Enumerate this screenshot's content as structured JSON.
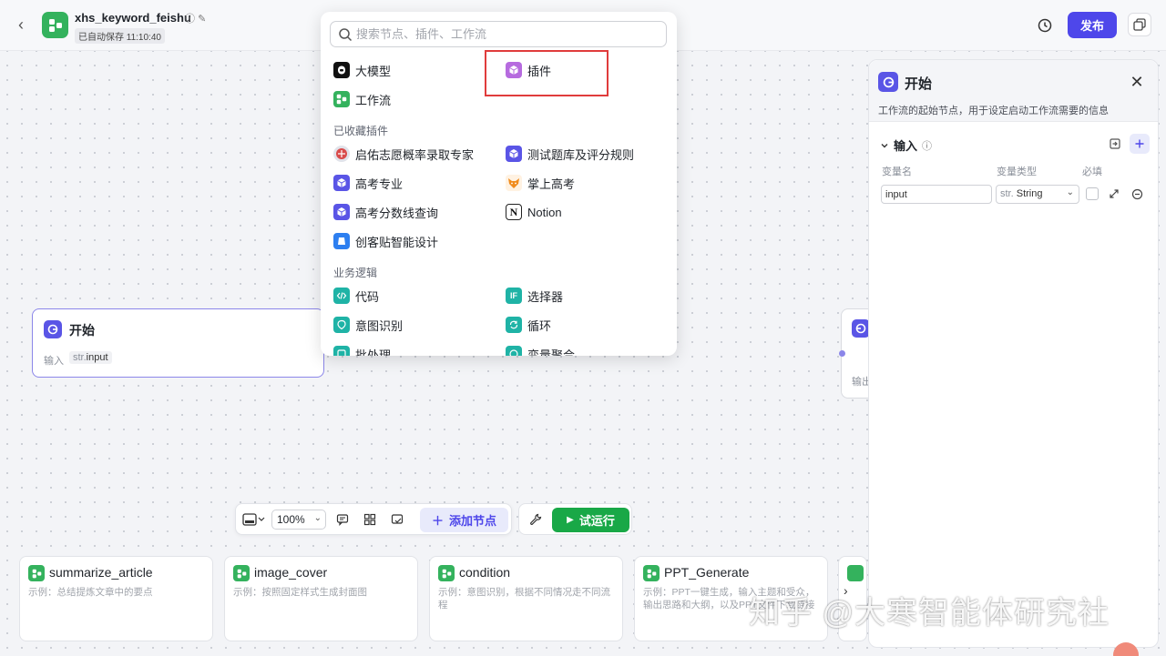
{
  "header": {
    "app_title": "xhs_keyword_feishu",
    "save_status": "已自动保存 11:10:40",
    "publish_label": "发布"
  },
  "canvas": {
    "start_node": {
      "title": "开始",
      "input_label": "输入",
      "input_chip_type": "str.",
      "input_chip_name": "input"
    },
    "end_node": {
      "output_label": "输出"
    }
  },
  "node_menu": {
    "search_placeholder": "搜索节点、插件、工作流",
    "top_items": [
      {
        "label": "大模型",
        "icon": "llm-icon"
      },
      {
        "label": "插件",
        "icon": "plugin-icon"
      },
      {
        "label": "工作流",
        "icon": "workflow-icon"
      }
    ],
    "favorites_title": "已收藏插件",
    "favorites": [
      {
        "label": "启佑志愿概率录取专家",
        "icon": "plugin-avatar-icon"
      },
      {
        "label": "测试题库及评分规则",
        "icon": "plugin-icon"
      },
      {
        "label": "高考专业",
        "icon": "plugin-icon"
      },
      {
        "label": "掌上高考",
        "icon": "fox-icon"
      },
      {
        "label": "高考分数线查询",
        "icon": "plugin-icon"
      },
      {
        "label": "Notion",
        "icon": "notion-icon"
      },
      {
        "label": "创客贴智能设计",
        "icon": "chuangkit-icon"
      }
    ],
    "logic_title": "业务逻辑",
    "logic": [
      {
        "label": "代码",
        "icon": "code-icon"
      },
      {
        "label": "选择器",
        "icon": "if-icon"
      },
      {
        "label": "意图识别",
        "icon": "intent-icon"
      },
      {
        "label": "循环",
        "icon": "loop-icon"
      },
      {
        "label": "批处理",
        "icon": "batch-icon"
      },
      {
        "label": "变量聚合",
        "icon": "aggregate-icon"
      }
    ]
  },
  "panel": {
    "title": "开始",
    "description": "工作流的起始节点，用于设定启动工作流需要的信息",
    "input_section": "输入",
    "columns": {
      "name": "变量名",
      "type": "变量类型",
      "required": "必填"
    },
    "variable": {
      "name": "input",
      "type_prefix": "str.",
      "type": "String",
      "required": false
    }
  },
  "toolbar": {
    "zoom": "100%",
    "add_node_label": "添加节点",
    "run_label": "试运行"
  },
  "templates": [
    {
      "title": "summarize_article",
      "desc": "示例：总结提炼文章中的要点"
    },
    {
      "title": "image_cover",
      "desc": "示例：按照固定样式生成封面图"
    },
    {
      "title": "condition",
      "desc": "示例：意图识别，根据不同情况走不同流程"
    },
    {
      "title": "PPT_Generate",
      "desc": "示例：PPT一键生成，输入主题和受众，输出思路和大纲，以及PPT文件下载链接"
    }
  ],
  "watermark": "知乎 @大寒智能体研究社",
  "colors": {
    "accent": "#4e47ea",
    "run": "#19a847",
    "workflow": "#34b25d",
    "highlight": "#e03c3c"
  }
}
